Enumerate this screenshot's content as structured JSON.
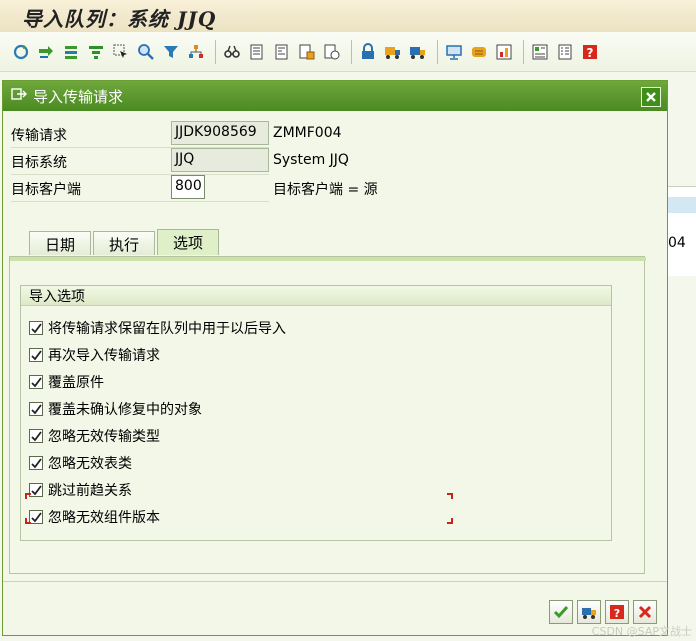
{
  "app": {
    "title": "导入队列：系统 JJQ"
  },
  "toolbar": {
    "icons": [
      "refresh-icon",
      "import-icon",
      "stack-icon",
      "filter-funnel-icon",
      "select-cursor-icon",
      "zoom-icon",
      "funnel-icon",
      "hierarchy-icon",
      "glasses-icon",
      "document-icon",
      "doc-lines-icon",
      "doc-stamp-icon",
      "doc-link-icon",
      "lock-icon",
      "truck-icon",
      "truck-alt-icon",
      "monitor-icon",
      "scroll-icon",
      "chart-icon",
      "layout-icon",
      "list-icon",
      "help-icon"
    ]
  },
  "dialog": {
    "title": "导入传输请求",
    "fields": {
      "transport_label": "传输请求",
      "transport_value": "JJDK908569",
      "transport_desc": "ZMMF004",
      "target_system_label": "目标系统",
      "target_system_value": "JJQ",
      "target_system_desc": "System JJQ",
      "target_client_label": "目标客户端",
      "target_client_value": "800",
      "target_client_desc": "目标客户端 = 源"
    },
    "tabs": [
      {
        "label": "日期"
      },
      {
        "label": "执行"
      },
      {
        "label": "选项"
      }
    ],
    "active_tab": "选项",
    "group_title": "导入选项",
    "options": [
      {
        "label": "将传输请求保留在队列中用于以后导入",
        "checked": true
      },
      {
        "label": "再次导入传输请求",
        "checked": true
      },
      {
        "label": "覆盖原件",
        "checked": true
      },
      {
        "label": "覆盖未确认修复中的对象",
        "checked": true
      },
      {
        "label": "忽略无效传输类型",
        "checked": true
      },
      {
        "label": "忽略无效表类",
        "checked": true
      },
      {
        "label": "跳过前趋关系",
        "checked": true
      },
      {
        "label": "忽略无效组件版本",
        "checked": true
      }
    ]
  },
  "background": {
    "right_value": "04"
  },
  "watermark": "CSDN @SAP文战士",
  "colors": {
    "header_green": "#4b8a22",
    "tab_active": "#dff0c8",
    "accent_red": "#c0281e"
  }
}
